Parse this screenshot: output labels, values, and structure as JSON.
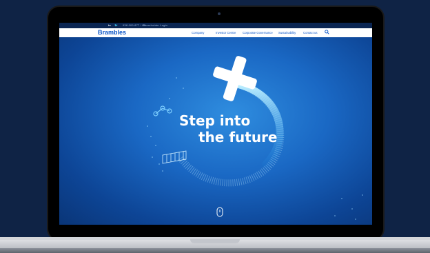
{
  "topbar": {
    "social": "in",
    "phone": "938 009  877 / 89",
    "shareholder": "Shareholder Login"
  },
  "nav": {
    "logo": "Brambles",
    "items": [
      "Company",
      "Investor Centre",
      "Corporate Governance",
      "Sustainability",
      "Contact us"
    ]
  },
  "hero": {
    "line1": "Step into",
    "line2": "the future"
  },
  "colors": {
    "accent": "#0a55c7",
    "background": "#0f2345"
  }
}
